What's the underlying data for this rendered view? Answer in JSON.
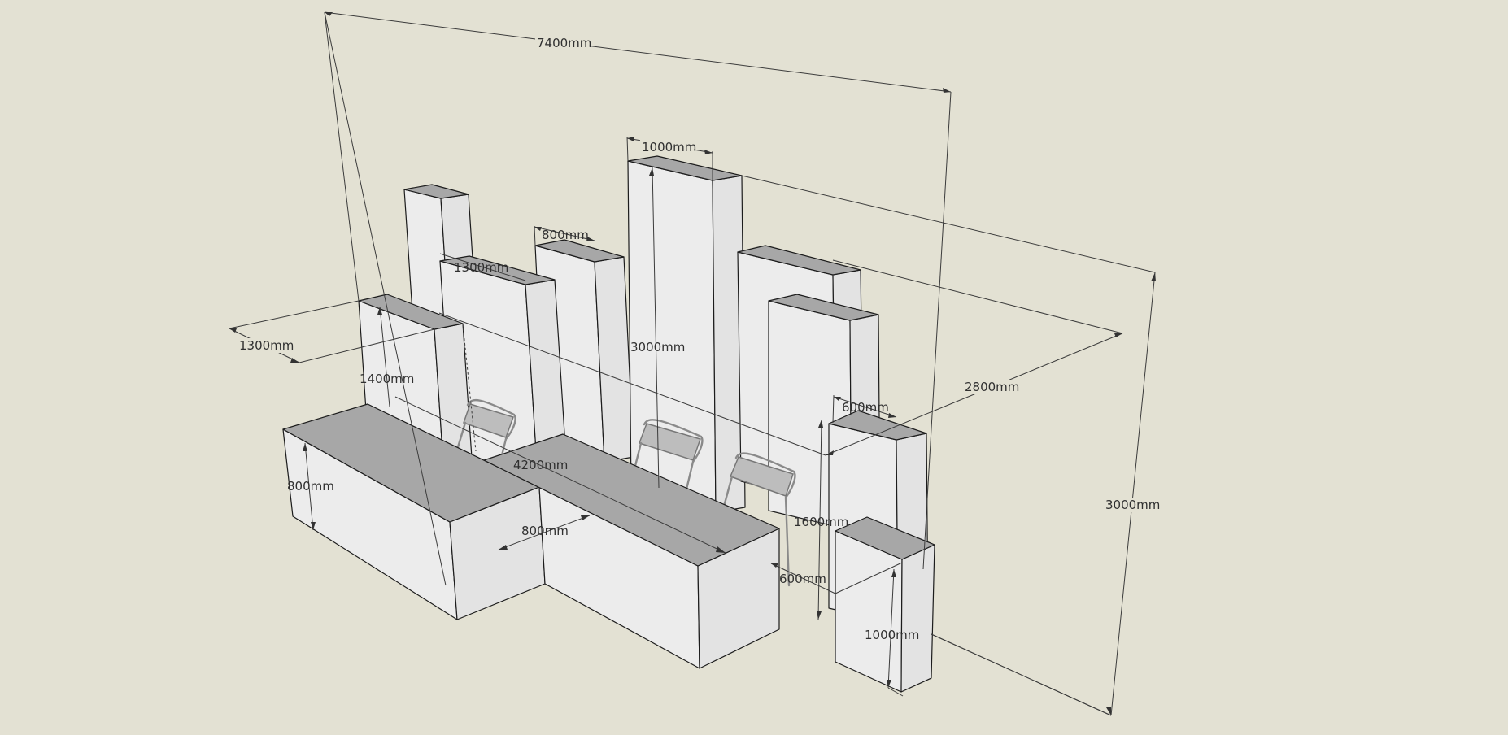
{
  "dimensions": {
    "overall_length": "7400mm",
    "overall_height": "3000mm",
    "overall_depth": "2800mm",
    "left_depth": "1300mm",
    "rear_left_depth": "1300mm",
    "tower_width": "800mm",
    "tall_tower_width": "1000mm",
    "tall_tower_height": "3000mm",
    "left_block_height": "1400mm",
    "counter_height": "800mm",
    "counter_length": "4200mm",
    "counter_depth": "800mm",
    "right_column_width": "600mm",
    "right_column_height": "1600mm",
    "small_block_depth": "600mm",
    "small_block_height": "1000mm"
  },
  "colors": {
    "background": "#e3e1d3",
    "top_faces": "#a7a7a7",
    "front_faces": "#ececec"
  }
}
